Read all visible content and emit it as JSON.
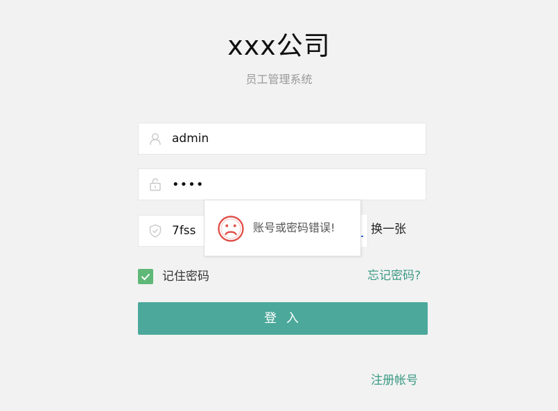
{
  "header": {
    "title": "xxx公司",
    "subtitle": "员工管理系统"
  },
  "form": {
    "username": {
      "value": "admin",
      "icon": "user-icon"
    },
    "password": {
      "value": "••••",
      "icon": "unlock-icon"
    },
    "captcha": {
      "value": "7fss",
      "icon": "shield-icon",
      "refresh_label": "换一张"
    },
    "remember": {
      "label": "记住密码",
      "checked": true
    },
    "forgot_label": "忘记密码?",
    "login_label": "登 入",
    "register_label": "注册帐号"
  },
  "popup": {
    "icon": "sad-face-icon",
    "message": "账号或密码错误!"
  },
  "colors": {
    "accent": "#4ba89a",
    "link": "#3a9a84",
    "checkbox": "#5fb878",
    "error_icon": "#e0504a",
    "background": "#f2f2f2"
  }
}
